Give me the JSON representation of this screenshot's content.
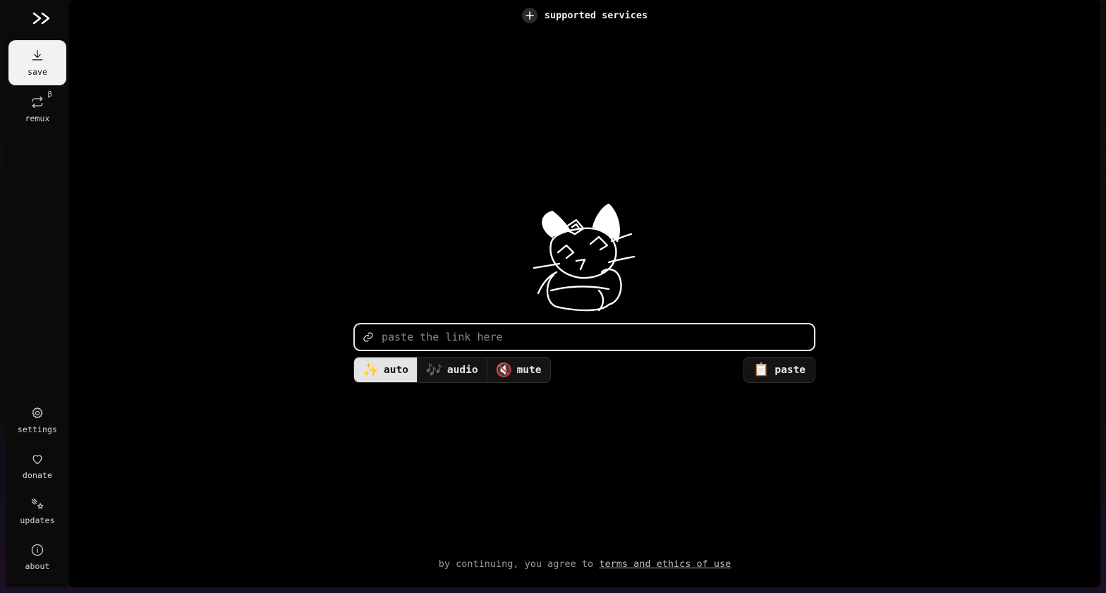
{
  "sidebar": {
    "logo": ">>",
    "top_items": [
      {
        "label": "save",
        "icon": "download-icon",
        "active": true
      },
      {
        "label": "remux",
        "icon": "repeat-icon",
        "badge": "β"
      }
    ],
    "bottom_items": [
      {
        "label": "settings",
        "icon": "gear-icon"
      },
      {
        "label": "donate",
        "icon": "heart-icon"
      },
      {
        "label": "updates",
        "icon": "sparkle-star-icon"
      },
      {
        "label": "about",
        "icon": "info-icon"
      }
    ]
  },
  "header": {
    "services_label": "supported services"
  },
  "input": {
    "placeholder": "paste the link here",
    "value": ""
  },
  "modes": [
    {
      "label": "auto",
      "emoji": "✨",
      "active": true
    },
    {
      "label": "audio",
      "emoji": "🎶",
      "active": false
    },
    {
      "label": "mute",
      "emoji": "🔇",
      "active": false
    }
  ],
  "paste": {
    "label": "paste",
    "emoji": "📋"
  },
  "footer": {
    "prefix": "by continuing, you agree to",
    "link": "terms and ethics of use"
  },
  "colors": {
    "background": "#000000",
    "sidebar": "#0b0b0c",
    "active_item": "#f2f2f2",
    "border": "#2e2e2e"
  }
}
